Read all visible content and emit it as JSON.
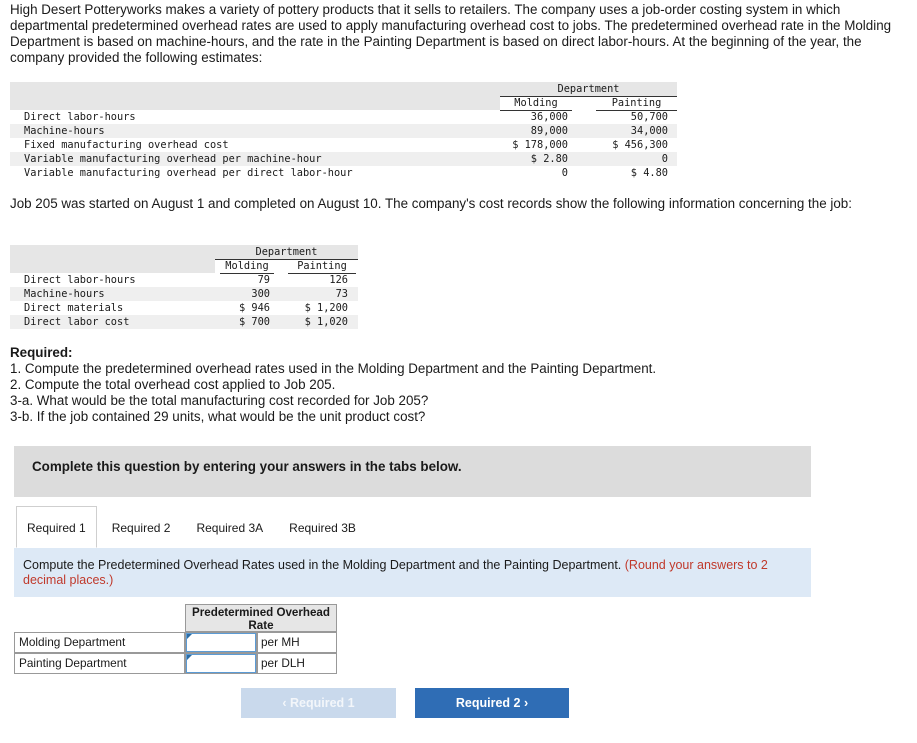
{
  "intro_text": "High Desert Potteryworks makes a variety of pottery products that it sells to retailers. The company uses a job-order costing system in which departmental predetermined overhead rates are used to apply manufacturing overhead cost to jobs. The predetermined overhead rate in the Molding Department is based on machine-hours, and the rate in the Painting Department is based on direct labor-hours. At the beginning of the year, the company provided the following estimates:",
  "estimates_table": {
    "group_header": "Department",
    "col_molding": "Molding",
    "col_painting": "Painting",
    "rows": [
      {
        "label": "Direct labor-hours",
        "molding": "36,000",
        "painting": "50,700"
      },
      {
        "label": "Machine-hours",
        "molding": "89,000",
        "painting": "34,000"
      },
      {
        "label": "Fixed manufacturing overhead cost",
        "molding": "$ 178,000",
        "painting": "$ 456,300"
      },
      {
        "label": "Variable manufacturing overhead per machine-hour",
        "molding": "$ 2.80",
        "painting": "0"
      },
      {
        "label": "Variable manufacturing overhead per direct labor-hour",
        "molding": "0",
        "painting": "$ 4.80"
      }
    ]
  },
  "job_intro_text": "Job 205 was started on August 1 and completed on August 10. The company's cost records show the following information concerning the job:",
  "job_table": {
    "group_header": "Department",
    "col_molding": "Molding",
    "col_painting": "Painting",
    "rows": [
      {
        "label": "Direct labor-hours",
        "molding": "79",
        "painting": "126"
      },
      {
        "label": "Machine-hours",
        "molding": "300",
        "painting": "73"
      },
      {
        "label": "Direct materials",
        "molding": "$ 946",
        "painting": "$ 1,200"
      },
      {
        "label": "Direct labor cost",
        "molding": "$ 700",
        "painting": "$ 1,020"
      }
    ]
  },
  "required": {
    "title": "Required:",
    "items": [
      "1. Compute the predetermined overhead rates used in the Molding Department and the Painting Department.",
      "2. Compute the total overhead cost applied to Job 205.",
      "3-a. What would be the total manufacturing cost recorded for Job 205?",
      "3-b. If the job contained 29 units, what would be the unit product cost?"
    ]
  },
  "banner_text": "Complete this question by entering your answers in the tabs below.",
  "tabs": [
    {
      "label": "Required 1",
      "active": true
    },
    {
      "label": "Required 2",
      "active": false
    },
    {
      "label": "Required 3A",
      "active": false
    },
    {
      "label": "Required 3B",
      "active": false
    }
  ],
  "instruction": {
    "text": "Compute the Predetermined Overhead Rates used in the Molding Department and the Painting Department.",
    "note": "(Round your answers to 2 decimal places.)"
  },
  "answer_table": {
    "header": "Predetermined Overhead Rate",
    "rows": [
      {
        "label": "Molding Department",
        "value": "",
        "unit": "per MH"
      },
      {
        "label": "Painting Department",
        "value": "",
        "unit": "per DLH"
      }
    ]
  },
  "nav": {
    "prev_label": "Required 1",
    "next_label": "Required 2"
  },
  "colors": {
    "next_button": "#2f6db5",
    "prev_button_disabled": "#c9d9ec",
    "instruction_bg": "#dde9f6",
    "note_red": "#c0392b"
  }
}
